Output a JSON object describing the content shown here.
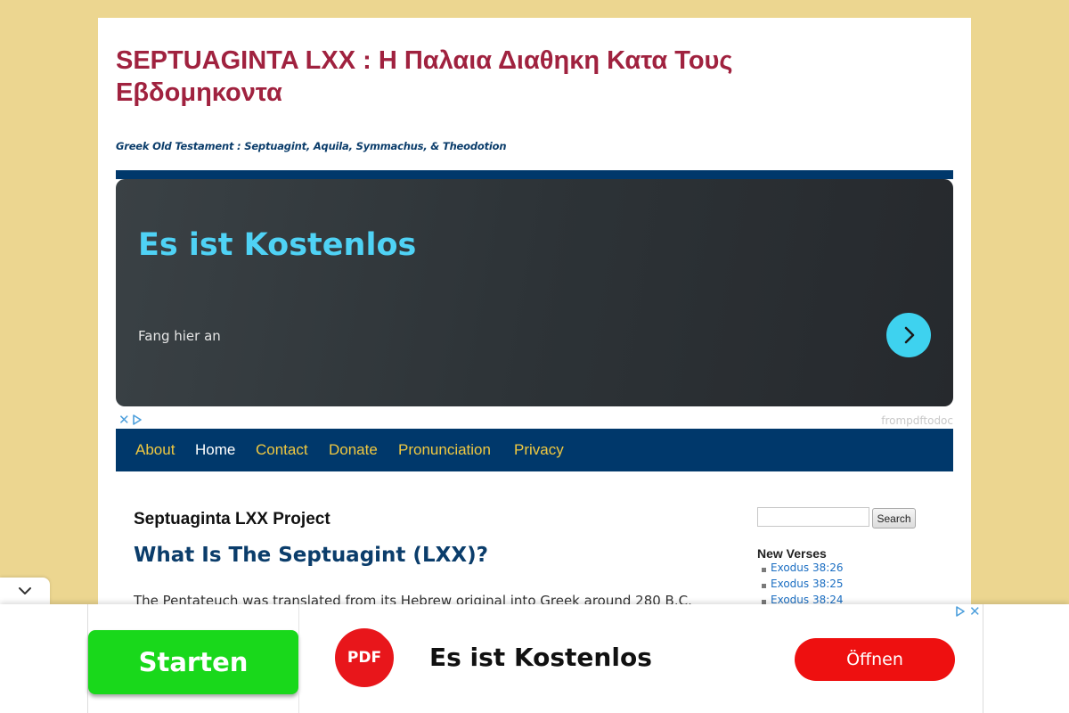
{
  "site": {
    "title": "SEPTUAGINTA LXX : Η Παλαια Διαθηκη Κατα Τους Εβδομηκοντα",
    "tagline": "Greek Old Testament : Septuagint, Aquila, Symmachus, & Theodotion"
  },
  "ad": {
    "headline": "Es ist Kostenlos",
    "subtext": "Fang hier an",
    "source": "frompdftodoc"
  },
  "nav": {
    "items": [
      {
        "label": "About"
      },
      {
        "label": "Home"
      },
      {
        "label": "Contact"
      },
      {
        "label": "Donate"
      },
      {
        "label": "Pronunciation"
      },
      {
        "label": "Privacy"
      }
    ],
    "current": "Home"
  },
  "content": {
    "page_title": "Septuaginta LXX Project",
    "heading": "What Is The Septuagint (LXX)?",
    "paragraph_visible": "The Pentateuch was translated from its Hebrew original into Greek around 280 B.C."
  },
  "sidebar": {
    "search_button": "Search",
    "new_verses_title": "New Verses",
    "verses": [
      "Exodus 38:26",
      "Exodus 38:25",
      "Exodus 38:24"
    ]
  },
  "anchor_ad": {
    "start_label": "Starten",
    "logo_text": "PDF",
    "headline": "Es ist Kostenlos",
    "open_label": "Öffnen"
  },
  "colors": {
    "background": "#ecd690",
    "title": "#a0223f",
    "nav_bg": "#00386b",
    "nav_link": "#f0c840",
    "heading": "#0b3d6b",
    "link": "#1b6ec2",
    "ad_accent": "#3ed2ef",
    "start_green": "#19d81b",
    "open_red": "#ee1010"
  }
}
